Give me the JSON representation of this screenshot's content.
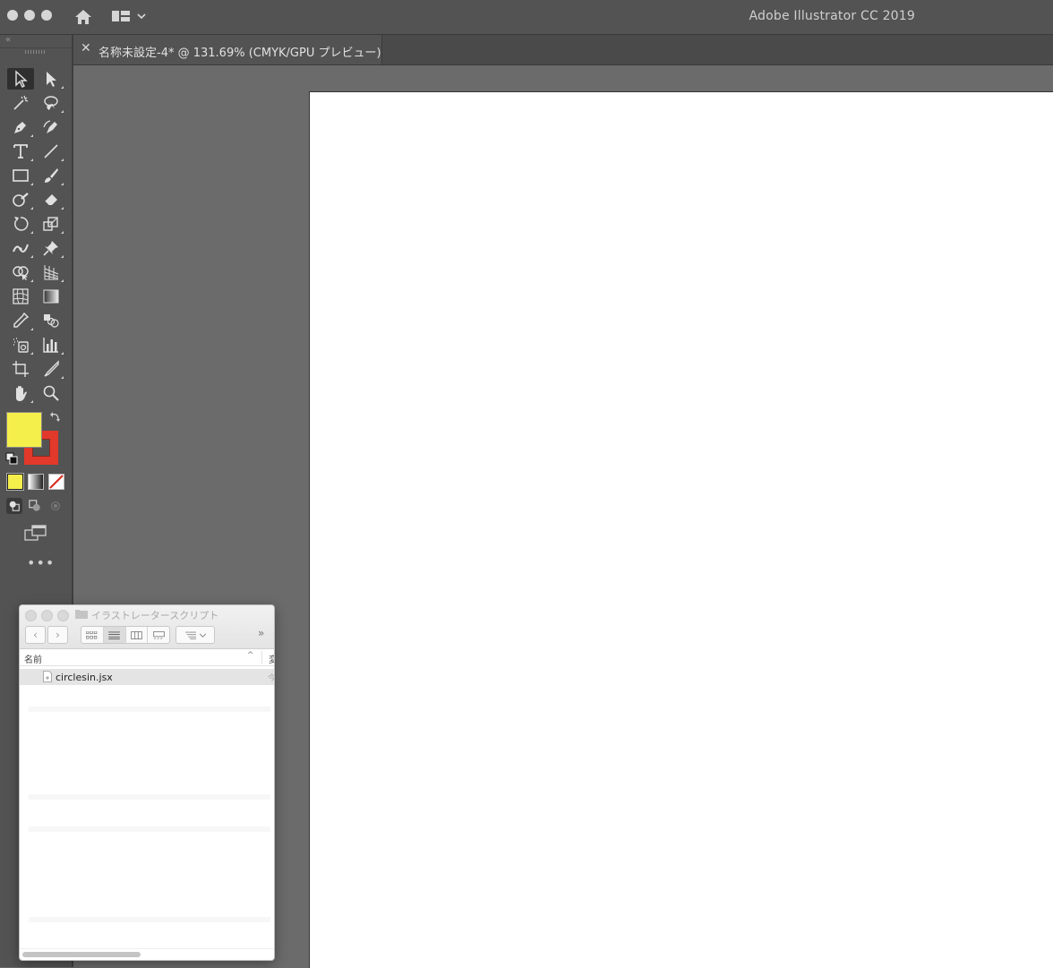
{
  "window": {
    "app_title": "Adobe Illustrator CC 2019"
  },
  "document": {
    "tab_label": "名称未設定-4* @ 131.69% (CMYK/GPU プレビュー)",
    "close_glyph": "✕"
  },
  "tools": [
    [
      "selection-tool",
      "direct-selection-tool"
    ],
    [
      "magic-wand-tool",
      "lasso-tool"
    ],
    [
      "pen-tool",
      "curvature-tool"
    ],
    [
      "type-tool",
      "line-segment-tool"
    ],
    [
      "rectangle-tool",
      "paintbrush-tool"
    ],
    [
      "shaper-tool",
      "eraser-tool"
    ],
    [
      "rotate-tool",
      "scale-tool"
    ],
    [
      "width-tool",
      "puppet-warp-tool"
    ],
    [
      "shape-builder-tool",
      "perspective-grid-tool"
    ],
    [
      "mesh-tool",
      "gradient-tool"
    ],
    [
      "eyedropper-tool",
      "blend-tool"
    ],
    [
      "symbol-sprayer-tool",
      "column-graph-tool"
    ],
    [
      "artboard-tool",
      "slice-tool"
    ],
    [
      "hand-tool",
      "zoom-tool"
    ]
  ],
  "colors": {
    "fill": "#f5ef4b",
    "stroke": "#e2392b",
    "toolbar_bg": "#535353",
    "canvas_bg": "#6b6b6b"
  },
  "toolbar": {
    "more_glyph": "•••"
  },
  "finder": {
    "title": "イラストレータースクリプト",
    "column_name": "名前",
    "column_next": "変",
    "sort_glyph": "^",
    "nav_back": "‹",
    "nav_forward": "›",
    "more_glyph": "»",
    "files": [
      {
        "name": "circlesin.jsx",
        "trail": "今"
      }
    ]
  }
}
